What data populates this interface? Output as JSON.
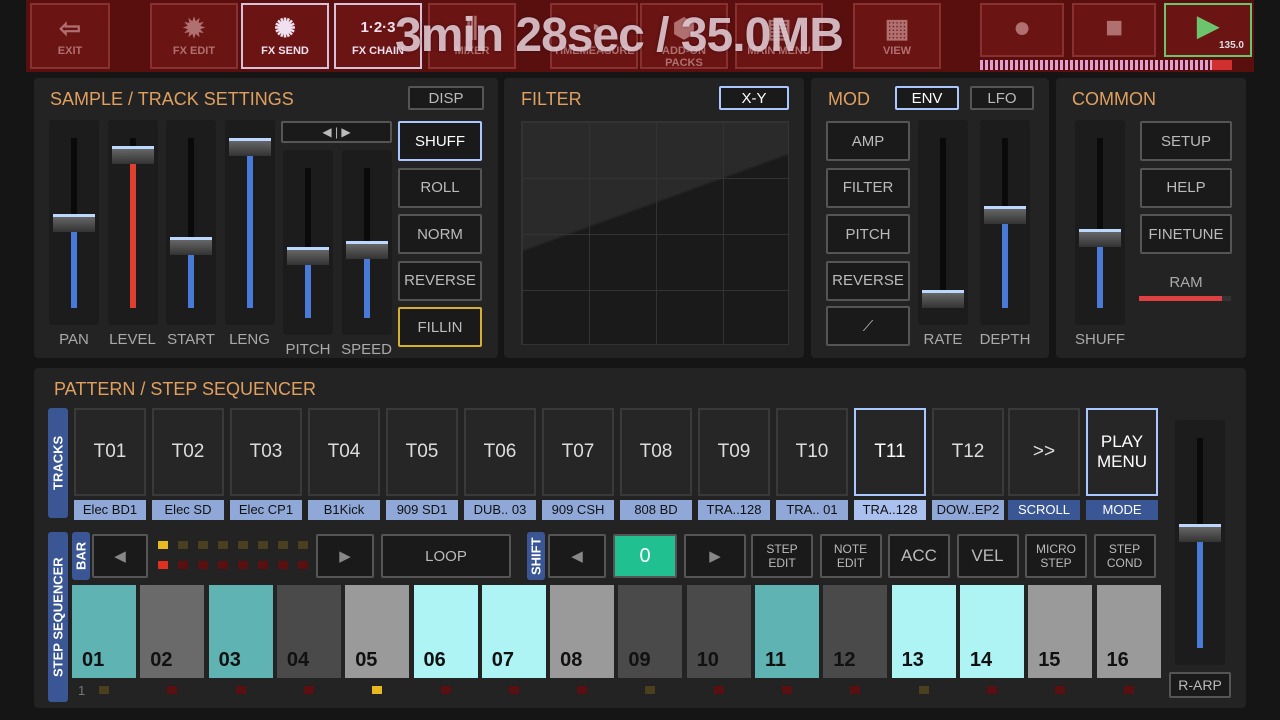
{
  "toolbar": {
    "buttons": [
      {
        "label": "EXIT",
        "icon": "exit-door-icon"
      },
      {
        "label": "FX EDIT",
        "icon": "fx-edit-icon"
      },
      {
        "label": "FX SEND",
        "icon": "fx-send-icon"
      },
      {
        "label": "FX CHAIN",
        "icon": "fx-chain-icon",
        "icon_text": "1·2·3"
      },
      {
        "label": "MIXER",
        "icon": "mixer-icon"
      },
      {
        "label": "TIMEMEASURE",
        "icon": "gauge-icon"
      },
      {
        "label": "ADD-ON PACKS",
        "icon": "box-icon"
      },
      {
        "label": "MAIN MENU",
        "icon": "menu-icon"
      },
      {
        "label": "VIEW",
        "icon": "grid-icon"
      }
    ],
    "record": "record-icon",
    "stop": "stop-icon",
    "play": "play-icon",
    "tempo": "135.0",
    "overlay": "3min 28sec / 35.0MB"
  },
  "sample": {
    "title": "SAMPLE / TRACK SETTINGS",
    "disp": "DISP",
    "faders": [
      {
        "label": "PAN",
        "value": 0.5
      },
      {
        "label": "LEVEL",
        "value": 0.95,
        "accent": "#e04030"
      },
      {
        "label": "START",
        "value": 0.35
      },
      {
        "label": "LENG",
        "value": 1.0
      },
      {
        "label": "PITCH",
        "value": 0.4
      },
      {
        "label": "SPEED",
        "value": 0.45
      }
    ],
    "buttons": [
      "SHUFF",
      "ROLL",
      "NORM",
      "REVERSE",
      "FILLIN"
    ]
  },
  "filter": {
    "title": "FILTER",
    "xy": "X-Y"
  },
  "mod": {
    "title": "MOD",
    "env": "ENV",
    "lfo": "LFO",
    "buttons": [
      "AMP",
      "FILTER",
      "PITCH",
      "REVERSE"
    ],
    "faders": [
      {
        "label": "RATE",
        "value": 0.0
      },
      {
        "label": "DEPTH",
        "value": 0.55
      }
    ]
  },
  "common": {
    "title": "COMMON",
    "fader": {
      "label": "SHUFF",
      "value": 0.4
    },
    "buttons": [
      "SETUP",
      "HELP",
      "FINETUNE"
    ],
    "ram": "RAM",
    "ram_level": 0.9
  },
  "sequencer": {
    "title": "PATTERN / STEP SEQUENCER",
    "tracks_tab": "TRACKS",
    "step_tab": "STEP SEQUENCER",
    "bar_tab": "BAR",
    "shift_tab": "SHIFT",
    "tracks": [
      {
        "id": "T01",
        "name": "Elec BD1"
      },
      {
        "id": "T02",
        "name": "Elec SD"
      },
      {
        "id": "T03",
        "name": "Elec CP1"
      },
      {
        "id": "T04",
        "name": "B1Kick"
      },
      {
        "id": "T05",
        "name": "909 SD1"
      },
      {
        "id": "T06",
        "name": "DUB.. 03"
      },
      {
        "id": "T07",
        "name": "909 CSH"
      },
      {
        "id": "T08",
        "name": "808 BD"
      },
      {
        "id": "T09",
        "name": "TRA..128"
      },
      {
        "id": "T10",
        "name": "TRA.. 01"
      },
      {
        "id": "T11",
        "name": "TRA..128"
      },
      {
        "id": "T12",
        "name": "DOW..EP2"
      }
    ],
    "scroll": ">>",
    "scroll_label": "SCROLL",
    "play_menu": "PLAY MENU",
    "mode": "MODE",
    "loop": "LOOP",
    "position": "0",
    "step_edit": "STEP EDIT",
    "note_edit": "NOTE EDIT",
    "acc": "ACC",
    "vel": "VEL",
    "micro_step": "MICRO STEP",
    "step_cond": "STEP COND",
    "steps": [
      {
        "n": "01",
        "c": "#5fb3b3"
      },
      {
        "n": "02",
        "c": "#6a6a6a"
      },
      {
        "n": "03",
        "c": "#5fb3b3"
      },
      {
        "n": "04",
        "c": "#4a4a4a"
      },
      {
        "n": "05",
        "c": "#9a9a9a"
      },
      {
        "n": "06",
        "c": "#aef4f4"
      },
      {
        "n": "07",
        "c": "#aef4f4"
      },
      {
        "n": "08",
        "c": "#9a9a9a"
      },
      {
        "n": "09",
        "c": "#4a4a4a"
      },
      {
        "n": "10",
        "c": "#4a4a4a"
      },
      {
        "n": "11",
        "c": "#5fb3b3"
      },
      {
        "n": "12",
        "c": "#4a4a4a"
      },
      {
        "n": "13",
        "c": "#aef4f4"
      },
      {
        "n": "14",
        "c": "#aef4f4"
      },
      {
        "n": "15",
        "c": "#9a9a9a"
      },
      {
        "n": "16",
        "c": "#9a9a9a"
      }
    ],
    "bar_number": "1",
    "rarp": "R-ARP",
    "volume": 0.55
  }
}
